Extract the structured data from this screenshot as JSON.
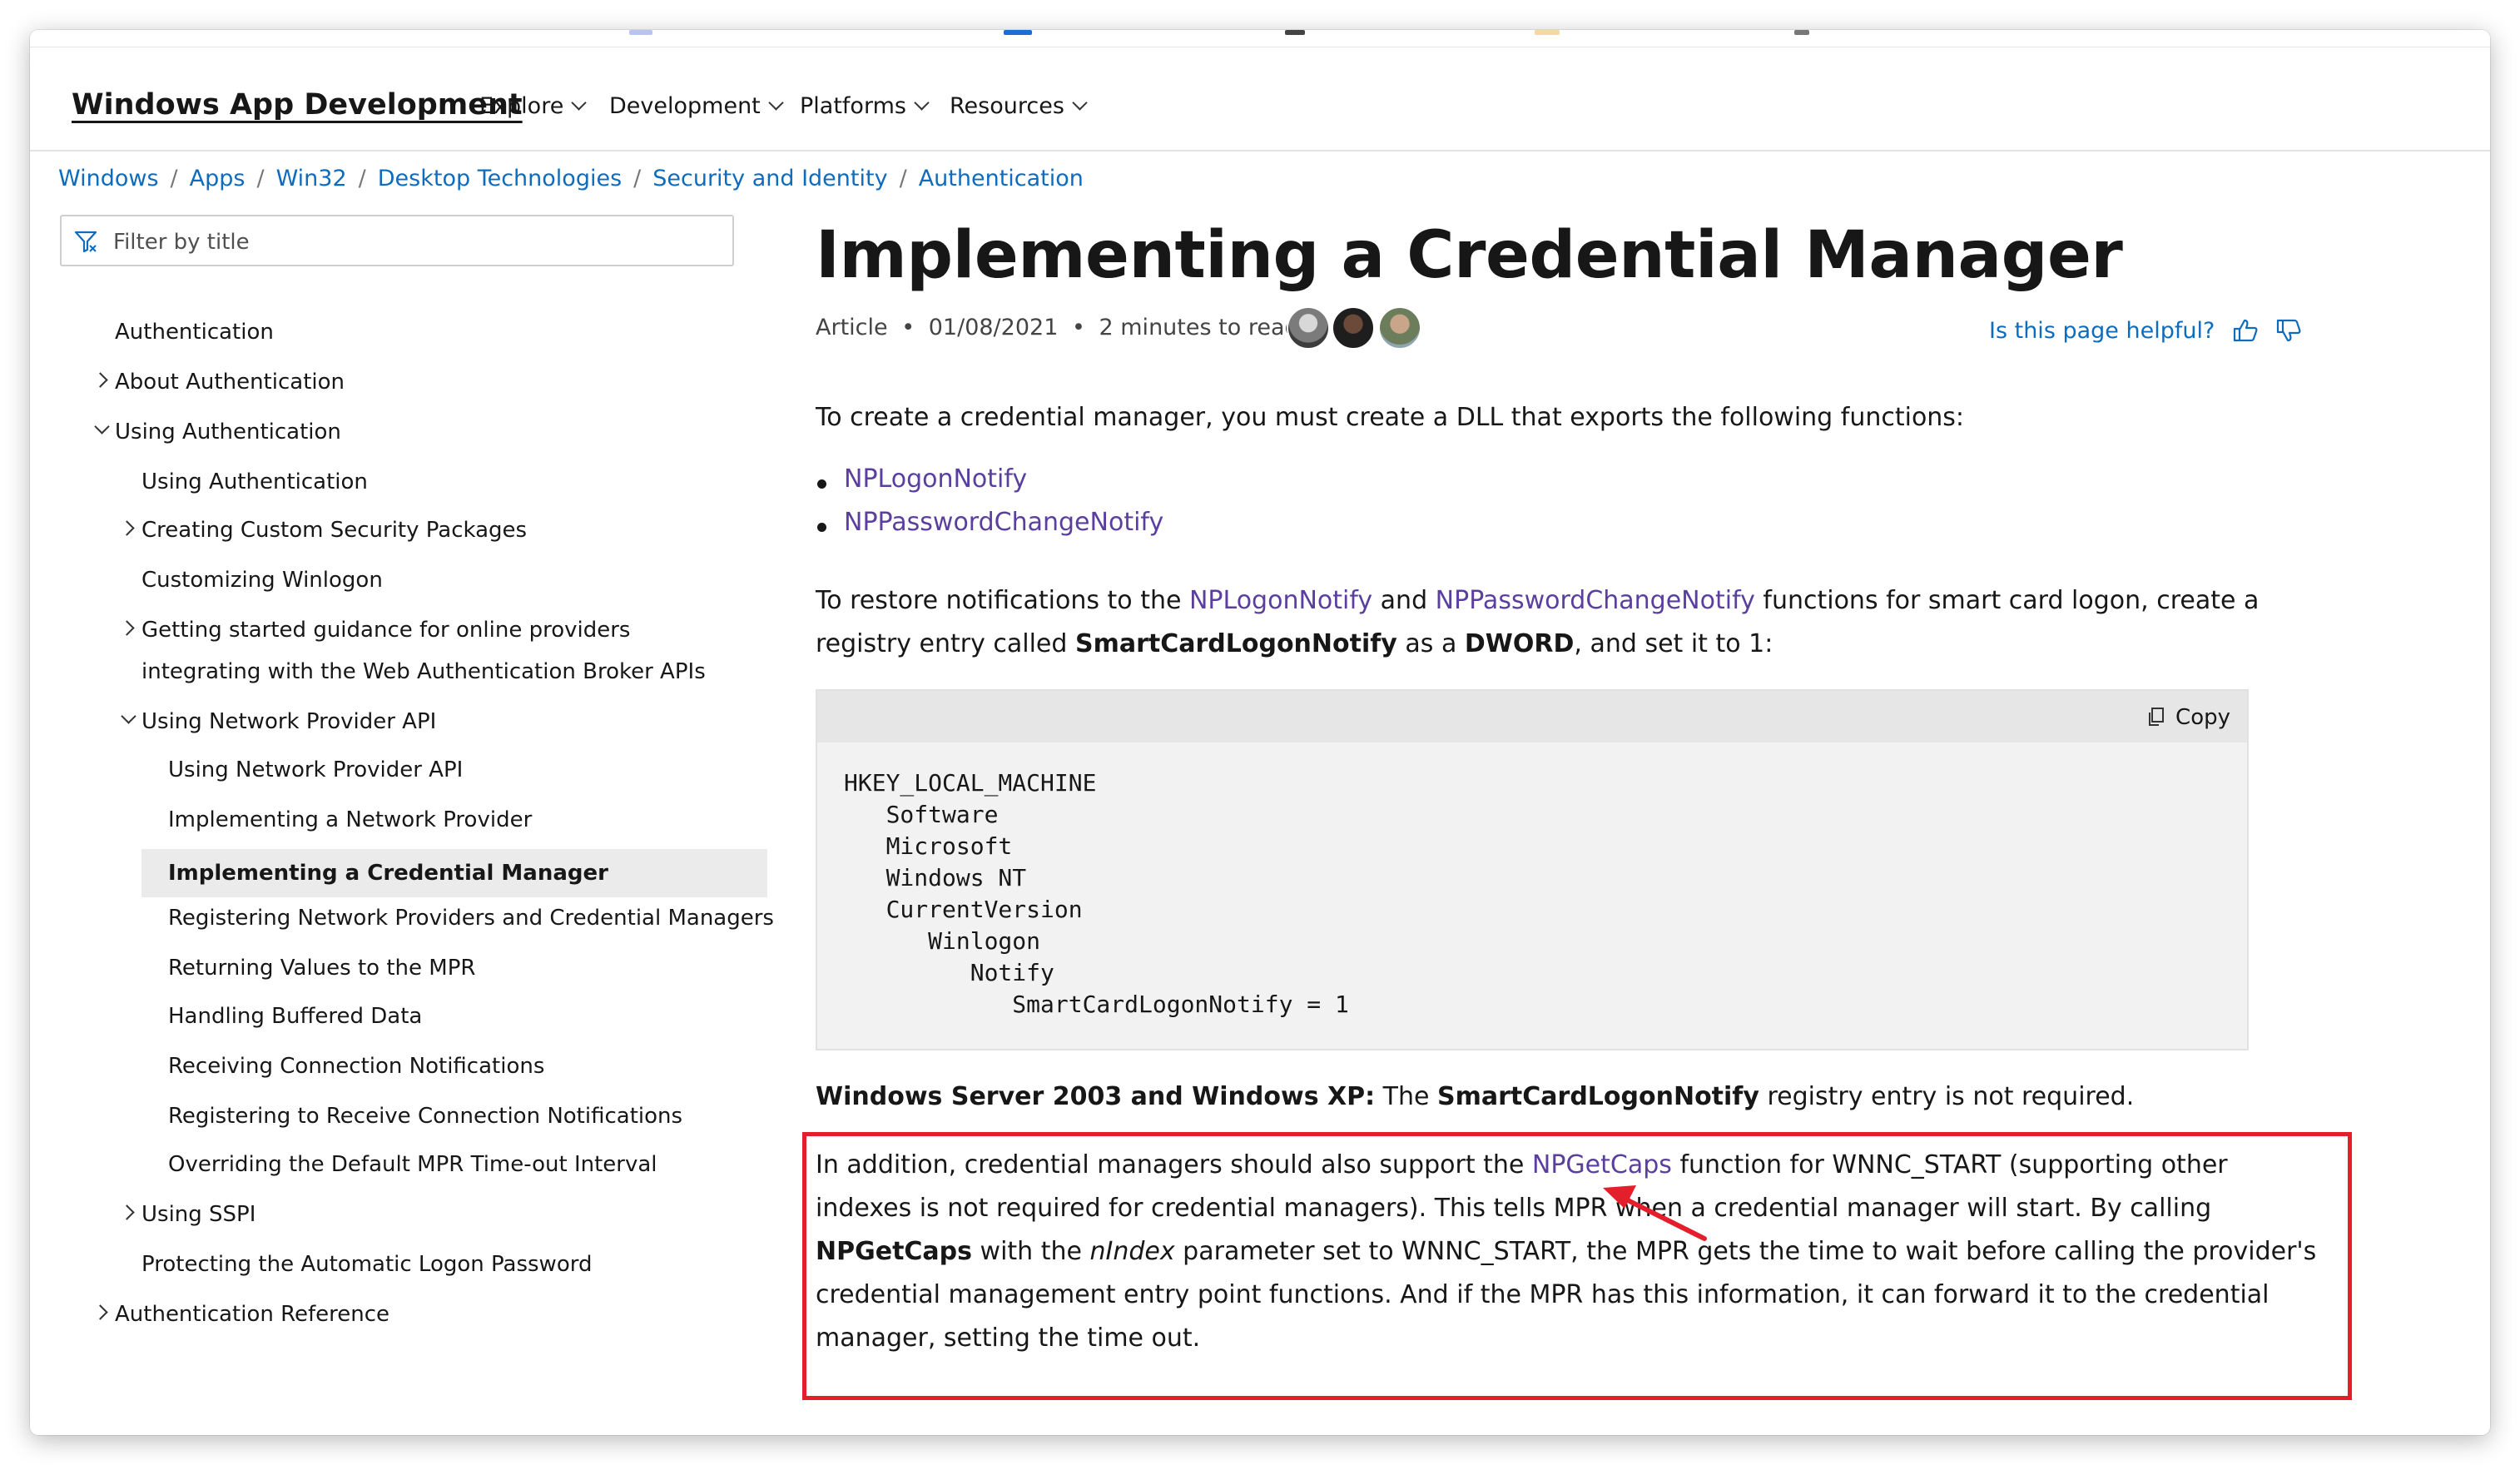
{
  "nav": {
    "brand": "Windows App Development",
    "menus": [
      "Explore",
      "Development",
      "Platforms",
      "Resources"
    ]
  },
  "breadcrumb": [
    "Windows",
    "Apps",
    "Win32",
    "Desktop Technologies",
    "Security and Identity",
    "Authentication"
  ],
  "sidebar": {
    "filter_placeholder": "Filter by title",
    "items": [
      {
        "label": "Authentication"
      },
      {
        "label": "About Authentication"
      },
      {
        "label": "Using Authentication"
      },
      {
        "label": "Using Authentication"
      },
      {
        "label": "Creating Custom Security Packages"
      },
      {
        "label": "Customizing Winlogon"
      },
      {
        "label": "Getting started guidance for online providers integrating with the Web Authentication Broker APIs"
      },
      {
        "label": "Using Network Provider API"
      },
      {
        "label": "Using Network Provider API"
      },
      {
        "label": "Implementing a Network Provider"
      },
      {
        "label": "Implementing a Credential Manager"
      },
      {
        "label": "Registering Network Providers and Credential Managers"
      },
      {
        "label": "Returning Values to the MPR"
      },
      {
        "label": "Handling Buffered Data"
      },
      {
        "label": "Receiving Connection Notifications"
      },
      {
        "label": "Registering to Receive Connection Notifications"
      },
      {
        "label": "Overriding the Default MPR Time-out Interval"
      },
      {
        "label": "Using SSPI"
      },
      {
        "label": "Protecting the Automatic Logon Password"
      },
      {
        "label": "Authentication Reference"
      }
    ]
  },
  "article": {
    "title": "Implementing a Credential Manager",
    "meta": {
      "type": "Article",
      "date": "01/08/2021",
      "read_time": "2 minutes to read",
      "sep": "•"
    },
    "helpful": "Is this page helpful?",
    "intro": "To create a credential manager, you must create a DLL that exports the following functions:",
    "bullets": [
      "NPLogonNotify",
      "NPPasswordChangeNotify"
    ],
    "restore": {
      "t1": "To restore notifications to the ",
      "link1": "NPLogonNotify",
      "t2": " and ",
      "link2": "NPPasswordChangeNotify",
      "t3": " functions for smart card logon, create a",
      "t4": "registry entry called ",
      "b1": "SmartCardLogonNotify",
      "t5": " as a ",
      "b2": "DWORD",
      "t6": ", and set it to 1:"
    },
    "copy_label": "Copy",
    "code_lines": [
      "HKEY_LOCAL_MACHINE",
      "   Software",
      "   Microsoft",
      "   Windows NT",
      "   CurrentVersion",
      "      Winlogon",
      "         Notify",
      "            SmartCardLogonNotify = 1"
    ],
    "note": {
      "b1": "Windows Server 2003 and Windows XP:",
      "t1": " The ",
      "b2": "SmartCardLogonNotify",
      "t2": " registry entry is not required."
    },
    "addition": {
      "l1a": "In addition, credential managers should also support the ",
      "l1link": "NPGetCaps",
      "l1b": " function for WNNC_START (supporting other",
      "l2": "indexes is not required for credential managers). This tells MPR when a credential manager will start. By calling",
      "l3b": "NPGetCaps",
      "l3a": " with the ",
      "l3i": "nIndex",
      "l3c": " parameter set to WNNC_START, the MPR gets the time to wait before calling the provider's",
      "l4": "credential management entry point functions. And if the MPR has this information, it can forward it to the credential",
      "l5": "manager, setting the time out."
    }
  },
  "colors": {
    "link": "#5a3f9e",
    "nav_link": "#0f6cbd",
    "highlight_box": "#e41f2c"
  }
}
